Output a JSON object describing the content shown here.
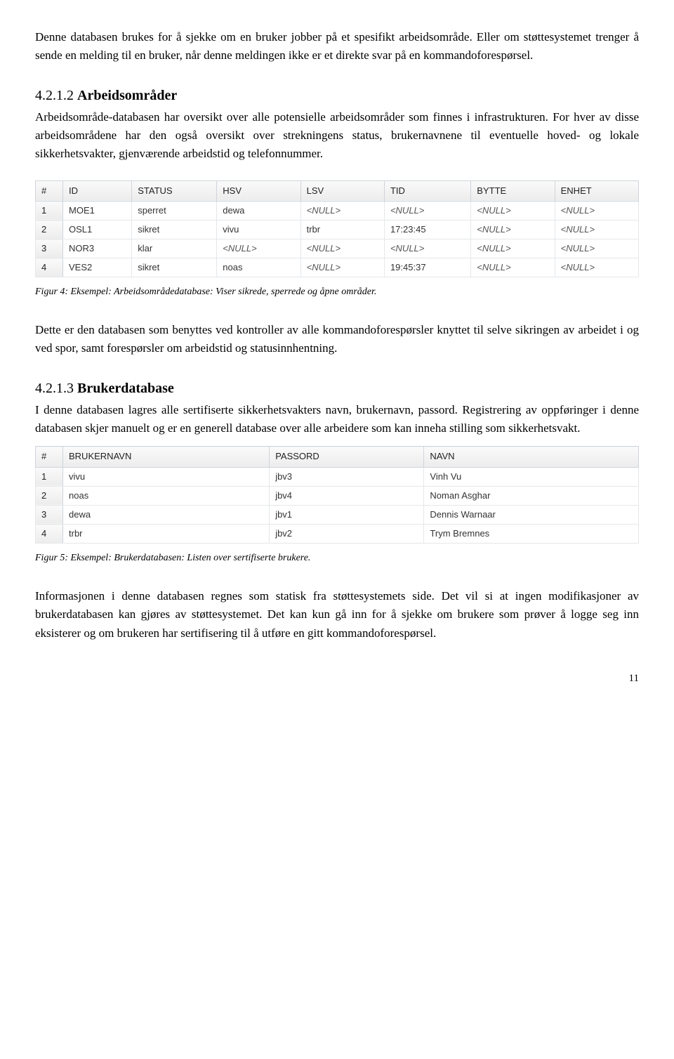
{
  "intro_para": "Denne databasen brukes for å sjekke om en bruker jobber på et spesifikt arbeidsområde. Eller om støttesystemet trenger å sende en melding til en bruker, når denne meldingen ikke er et direkte svar på en kommandoforespørsel.",
  "sec1": {
    "number": "4.2.1.2 ",
    "title": "Arbeidsområder",
    "para1": "Arbeidsområde-databasen har oversikt over alle potensielle arbeidsområder som finnes i infrastrukturen. For hver av disse arbeidsområdene har den også oversikt over strekningens status, brukernavnene til eventuelle hoved- og lokale sikkerhetsvakter, gjenværende arbeidstid og telefonnummer.",
    "table": {
      "headers": [
        "#",
        "ID",
        "STATUS",
        "HSV",
        "LSV",
        "TID",
        "BYTTE",
        "ENHET"
      ],
      "rows": [
        [
          "1",
          "MOE1",
          "sperret",
          "dewa",
          "<NULL>",
          "<NULL>",
          "<NULL>",
          "<NULL>"
        ],
        [
          "2",
          "OSL1",
          "sikret",
          "vivu",
          "trbr",
          "17:23:45",
          "<NULL>",
          "<NULL>"
        ],
        [
          "3",
          "NOR3",
          "klar",
          "<NULL>",
          "<NULL>",
          "<NULL>",
          "<NULL>",
          "<NULL>"
        ],
        [
          "4",
          "VES2",
          "sikret",
          "noas",
          "<NULL>",
          "19:45:37",
          "<NULL>",
          "<NULL>"
        ]
      ]
    },
    "caption": "Figur 4: Eksempel: Arbeidsområdedatabase: Viser sikrede, sperrede og åpne områder.",
    "para2": "Dette er den databasen som benyttes ved kontroller av alle kommandoforespørsler knyttet til selve sikringen av arbeidet i og ved spor, samt forespørsler om arbeidstid og statusinnhentning."
  },
  "sec2": {
    "number": "4.2.1.3 ",
    "title": "Brukerdatabase",
    "para1": "I denne databasen lagres alle sertifiserte sikkerhetsvakters navn, brukernavn, passord. Registrering av oppføringer i denne databasen skjer manuelt og er en generell database over alle arbeidere som kan inneha stilling som sikkerhetsvakt.",
    "table": {
      "headers": [
        "#",
        "BRUKERNAVN",
        "PASSORD",
        "NAVN"
      ],
      "rows": [
        [
          "1",
          "vivu",
          "jbv3",
          "Vinh Vu"
        ],
        [
          "2",
          "noas",
          "jbv4",
          "Noman Asghar"
        ],
        [
          "3",
          "dewa",
          "jbv1",
          "Dennis Warnaar"
        ],
        [
          "4",
          "trbr",
          "jbv2",
          "Trym Bremnes"
        ]
      ]
    },
    "caption": "Figur 5: Eksempel: Brukerdatabasen: Listen over sertifiserte brukere.",
    "para2": "Informasjonen i denne databasen regnes som statisk fra støttesystemets side. Det vil si at ingen modifikasjoner av brukerdatabasen kan gjøres av støttesystemet. Det kan kun gå inn for å sjekke om brukere som prøver å logge seg inn eksisterer og om brukeren har sertifisering til å utføre en gitt kommandoforespørsel."
  },
  "page_number": "11"
}
